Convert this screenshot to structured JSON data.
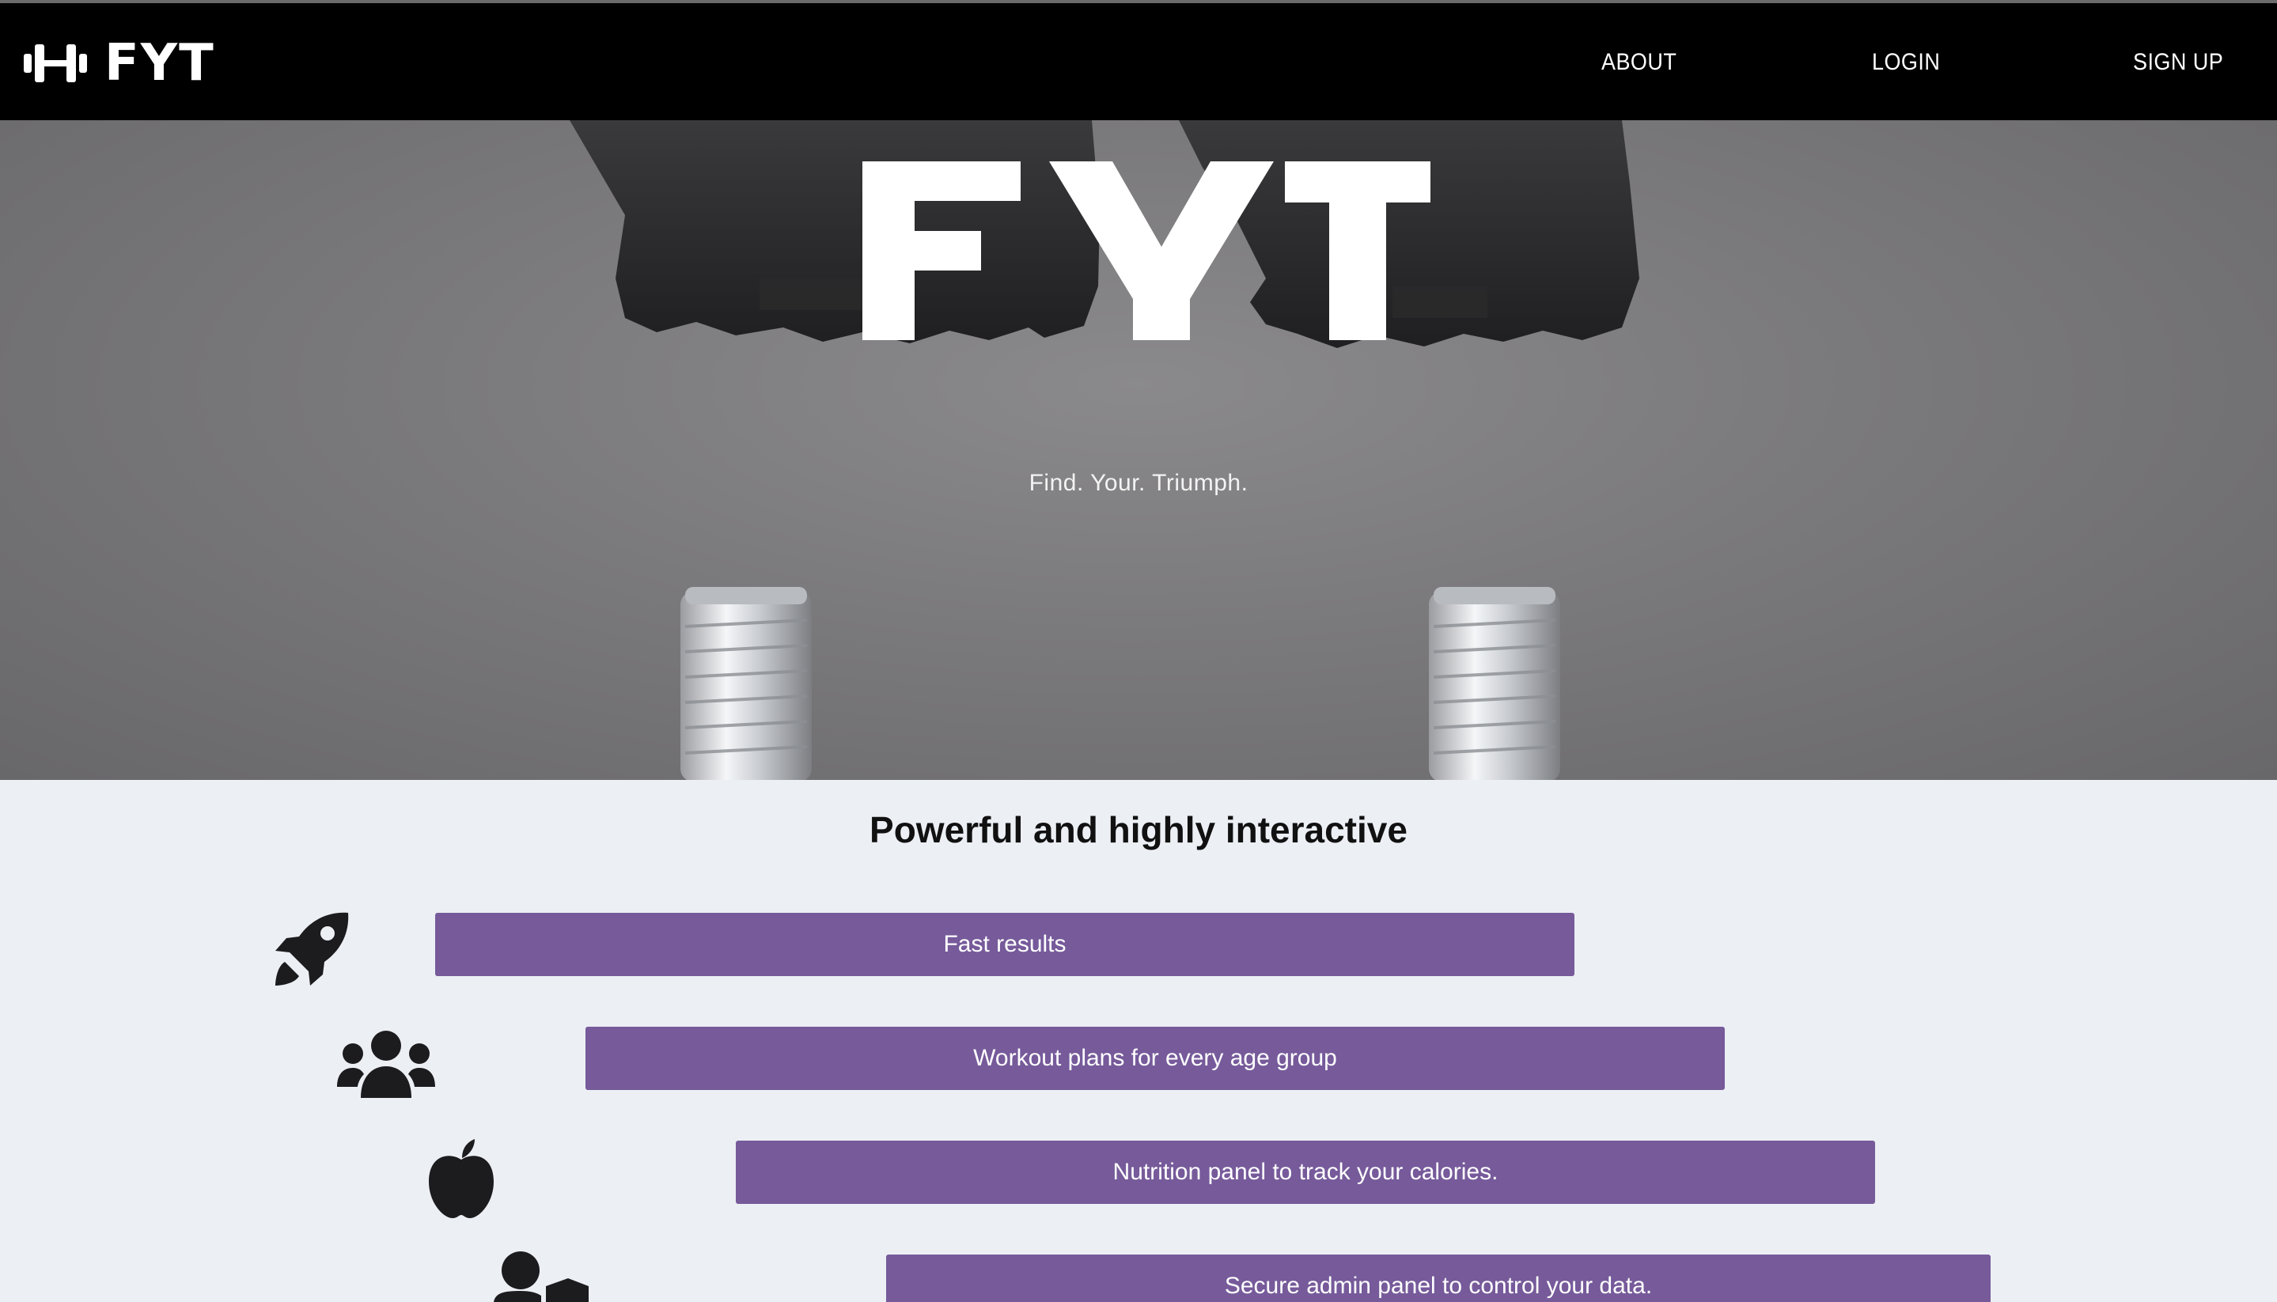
{
  "nav": {
    "logo_text": "FYT",
    "logo_icon": "dumbbell-icon",
    "links": [
      "ABOUT",
      "LOGIN",
      "SIGN UP"
    ]
  },
  "hero": {
    "title": "FYT",
    "tagline": "Find. Your. Triumph."
  },
  "features": {
    "title": "Powerful and highly interactive",
    "items": [
      {
        "icon": "rocket-icon",
        "label": "Fast results"
      },
      {
        "icon": "users-icon",
        "label": "Workout plans for every age group"
      },
      {
        "icon": "apple-icon",
        "label": "Nutrition panel to track your calories."
      },
      {
        "icon": "user-shield-icon",
        "label": "Secure admin panel to control your data."
      }
    ]
  },
  "colors": {
    "navbar": "#000000",
    "feature_bar": "#765a9a",
    "page_background": "#eceff4"
  }
}
